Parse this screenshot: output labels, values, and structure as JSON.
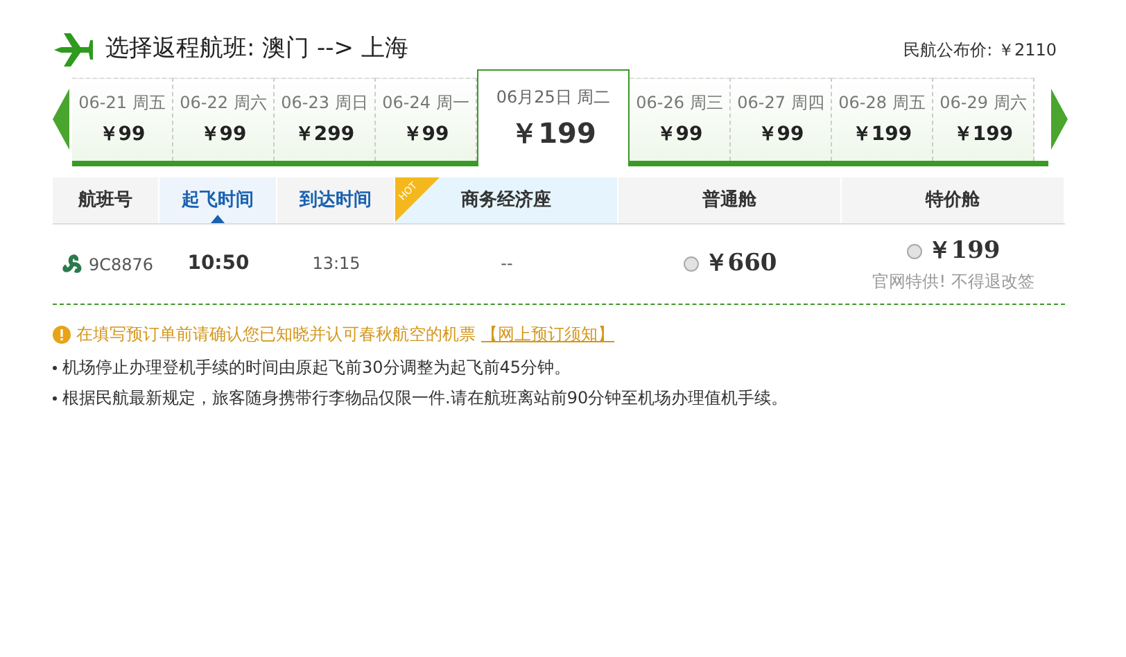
{
  "header": {
    "title": "选择返程航班: 澳门 --> 上海",
    "reference_price": "民航公布价: ￥2110"
  },
  "dates": [
    {
      "date": "06-21 周五",
      "price": "￥99",
      "selected": false
    },
    {
      "date": "06-22 周六",
      "price": "￥99",
      "selected": false
    },
    {
      "date": "06-23 周日",
      "price": "￥299",
      "selected": false
    },
    {
      "date": "06-24 周一",
      "price": "￥99",
      "selected": false
    },
    {
      "date": "06月25日 周二",
      "price": "￥199",
      "selected": true
    },
    {
      "date": "06-26 周三",
      "price": "￥99",
      "selected": false
    },
    {
      "date": "06-27 周四",
      "price": "￥99",
      "selected": false
    },
    {
      "date": "06-28 周五",
      "price": "￥199",
      "selected": false
    },
    {
      "date": "06-29 周六",
      "price": "￥199",
      "selected": false
    }
  ],
  "table": {
    "columns": [
      {
        "label": "航班号",
        "kind": "plain"
      },
      {
        "label": "起飞时间",
        "kind": "sort",
        "selected": true
      },
      {
        "label": "到达时间",
        "kind": "sort",
        "selected": false
      },
      {
        "label": "商务经济座",
        "kind": "hot",
        "badge": "HOT"
      },
      {
        "label": "普通舱",
        "kind": "plain"
      },
      {
        "label": "特价舱",
        "kind": "plain"
      }
    ],
    "rows": [
      {
        "flight": "9C8876",
        "depart": "10:50",
        "arrive": "13:15",
        "business": "--",
        "fares": [
          {
            "price": "￥660",
            "selected": false
          },
          {
            "price": "￥199",
            "selected": false,
            "note": "官网特供! 不得退改签"
          }
        ]
      }
    ]
  },
  "notice": {
    "text": "在填写预订单前请确认您已知晓并认可春秋航空的机票",
    "link": "【网上预订须知】"
  },
  "bullets": [
    "机场停止办理登机手续的时间由原起飞前30分调整为起飞前45分钟。",
    "根据民航最新规定，旅客随身携带行李物品仅限一件.请在航班离站前90分钟至机场办理值机手续。"
  ]
}
